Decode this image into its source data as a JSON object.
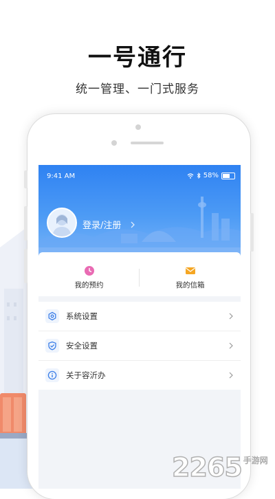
{
  "promo": {
    "headline": "一号通行",
    "subline": "统一管理、一门式服务"
  },
  "status_bar": {
    "time": "9:41 AM",
    "battery": "58%"
  },
  "profile": {
    "login_label": "登录/注册"
  },
  "quick_actions": [
    {
      "label": "我的预约",
      "icon": "clock-icon",
      "color": "#e96bb3"
    },
    {
      "label": "我的信箱",
      "icon": "mail-icon",
      "color": "#f5a623"
    }
  ],
  "menu": [
    {
      "label": "系统设置",
      "icon": "gear-icon"
    },
    {
      "label": "安全设置",
      "icon": "shield-icon"
    },
    {
      "label": "关于容沂办",
      "icon": "info-icon"
    }
  ],
  "watermark": {
    "number": "2265",
    "text": "手游网"
  },
  "colors": {
    "hero_blue": "#2f82f2",
    "menu_icon": "#3b7ee8"
  }
}
